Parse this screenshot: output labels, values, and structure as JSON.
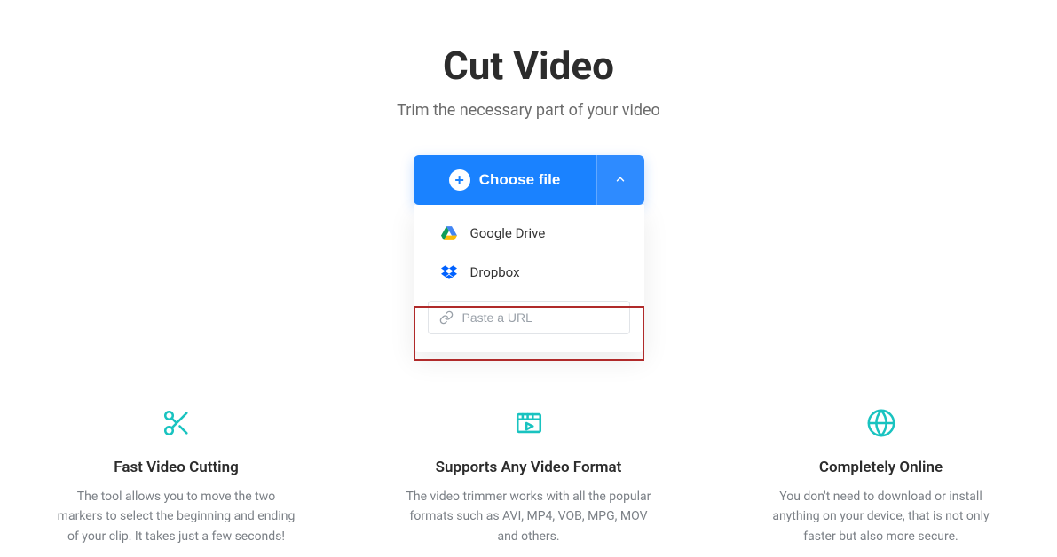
{
  "header": {
    "title": "Cut Video",
    "subtitle": "Trim the necessary part of your video"
  },
  "upload": {
    "choose_label": "Choose file",
    "options": {
      "gdrive": "Google Drive",
      "dropbox": "Dropbox"
    },
    "url_placeholder": "Paste a URL"
  },
  "features": [
    {
      "title": "Fast Video Cutting",
      "desc": "The tool allows you to move the two markers to select the beginning and ending of your clip. It takes just a few seconds!"
    },
    {
      "title": "Supports Any Video Format",
      "desc": "The video trimmer works with all the popular formats such as AVI, MP4, VOB, MPG, MOV and others."
    },
    {
      "title": "Completely Online",
      "desc": "You don't need to download or install anything on your device, that is not only faster but also more secure."
    }
  ]
}
